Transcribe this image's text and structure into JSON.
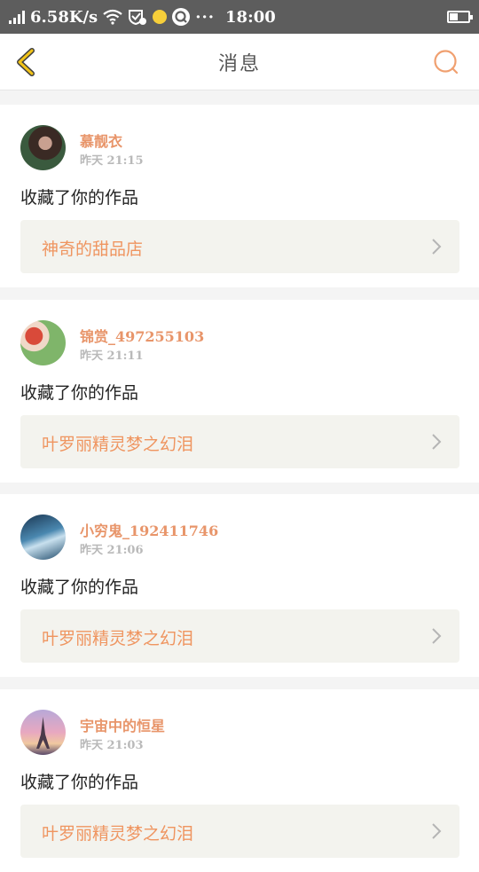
{
  "status_bar": {
    "speed": "6.58K/s",
    "time": "18:00",
    "icons": [
      "signal-icon",
      "wifi-icon",
      "vpn-icon",
      "notification-dot-icon",
      "app-q-icon",
      "more-icon",
      "battery-icon"
    ]
  },
  "nav": {
    "title": "消息",
    "accent_color": "#f0a070",
    "back_color": "#f2c318"
  },
  "messages": [
    {
      "user": "慕靓衣",
      "time": "昨天 21:15",
      "action": "收藏了你的作品",
      "work": "神奇的甜品店",
      "avatar_colors": [
        "#3a4a3e",
        "#6b4a3a"
      ]
    },
    {
      "user": "锦赏_497255103",
      "time": "昨天 21:11",
      "action": "收藏了你的作品",
      "work": "叶罗丽精灵梦之幻泪",
      "avatar_colors": [
        "#d94a3a",
        "#7fb56a"
      ]
    },
    {
      "user": "小穷鬼_192411746",
      "time": "昨天 21:06",
      "action": "收藏了你的作品",
      "work": "叶罗丽精灵梦之幻泪",
      "avatar_colors": [
        "#1f4a6a",
        "#6aa8c8"
      ]
    },
    {
      "user": "宇宙中的恒星",
      "time": "昨天 21:03",
      "action": "收藏了你的作品",
      "work": "叶罗丽精灵梦之幻泪",
      "avatar_colors": [
        "#e8a8c0",
        "#5a5a8a"
      ]
    }
  ]
}
